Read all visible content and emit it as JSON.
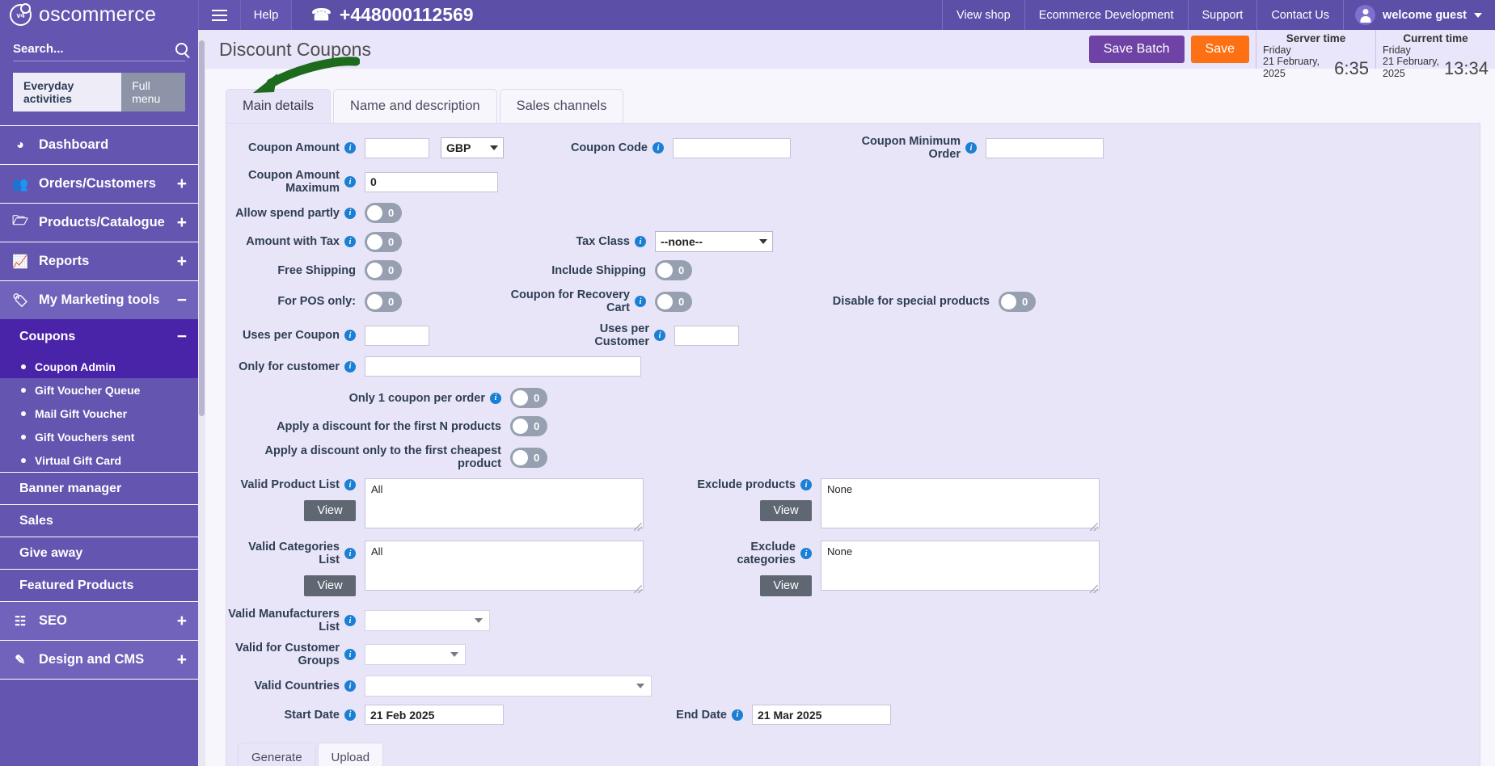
{
  "topbar": {
    "brand": "oscommerce",
    "logo_text": "v4",
    "help": "Help",
    "phone": "+448000112569",
    "nav": [
      {
        "label": "View shop"
      },
      {
        "label": "Ecommerce Development"
      },
      {
        "label": "Support"
      },
      {
        "label": "Contact Us"
      }
    ],
    "user": "welcome guest"
  },
  "sidebar": {
    "search_placeholder": "Search...",
    "toggle_tabs": [
      {
        "label": "Everyday activities",
        "active": true
      },
      {
        "label": "Full menu",
        "active": false
      }
    ],
    "items": [
      {
        "label": "Dashboard",
        "icon": "dashboard-icon",
        "expander": ""
      },
      {
        "label": "Orders/Customers",
        "icon": "users-icon",
        "expander": "+"
      },
      {
        "label": "Products/Catalogue",
        "icon": "folder-icon",
        "expander": "+"
      },
      {
        "label": "Reports",
        "icon": "chart-icon",
        "expander": "+"
      },
      {
        "label": "My Marketing tools",
        "icon": "tag-icon",
        "expander": "−"
      }
    ],
    "coupons_group": {
      "label": "Coupons",
      "expander": "−"
    },
    "coupons_children": [
      {
        "label": "Coupon Admin",
        "selected": true
      },
      {
        "label": "Gift Voucher Queue",
        "selected": false
      },
      {
        "label": "Mail Gift Voucher",
        "selected": false
      },
      {
        "label": "Gift Vouchers sent",
        "selected": false
      },
      {
        "label": "Virtual Gift Card",
        "selected": false
      }
    ],
    "flat_items": [
      {
        "label": "Banner manager"
      },
      {
        "label": "Sales"
      },
      {
        "label": "Give away"
      },
      {
        "label": "Featured Products"
      }
    ],
    "bottom_items": [
      {
        "label": "SEO",
        "icon": "sitemap-icon",
        "expander": "+"
      },
      {
        "label": "Design and CMS",
        "icon": "brush-icon",
        "expander": "+"
      }
    ]
  },
  "header": {
    "title": "Discount Coupons",
    "save_batch": "Save Batch",
    "save": "Save",
    "server_time": {
      "label": "Server time",
      "day": "Friday",
      "date": "21 February, 2025",
      "clock": "6:35"
    },
    "current_time": {
      "label": "Current time",
      "day": "Friday",
      "date": "21 February, 2025",
      "clock": "13:34"
    }
  },
  "tabs": [
    {
      "label": "Main details",
      "active": true
    },
    {
      "label": "Name and description",
      "active": false
    },
    {
      "label": "Sales channels",
      "active": false
    }
  ],
  "form": {
    "coupon_amount": {
      "label": "Coupon Amount",
      "value": "",
      "info": true
    },
    "currency": {
      "value": "GBP"
    },
    "coupon_code": {
      "label": "Coupon Code",
      "value": "",
      "info": true
    },
    "coupon_min_order": {
      "label": "Coupon Minimum Order",
      "value": "",
      "info": true
    },
    "coupon_amount_max": {
      "label": "Coupon Amount Maximum",
      "value": "0",
      "info": true
    },
    "allow_spend_partly": {
      "label": "Allow spend partly",
      "value": "0",
      "info": true
    },
    "amount_with_tax": {
      "label": "Amount with Tax",
      "value": "0",
      "info": true
    },
    "tax_class": {
      "label": "Tax Class",
      "value": "--none--",
      "info": true
    },
    "free_shipping": {
      "label": "Free Shipping",
      "value": "0",
      "info": false
    },
    "include_shipping": {
      "label": "Include Shipping",
      "value": "0",
      "info": false
    },
    "for_pos_only": {
      "label": "For POS only:",
      "value": "0",
      "info": false
    },
    "coupon_recovery_cart": {
      "label": "Coupon for Recovery Cart",
      "value": "0",
      "info": true
    },
    "disable_special_products": {
      "label": "Disable for special products",
      "value": "0",
      "info": false
    },
    "uses_per_coupon": {
      "label": "Uses per Coupon",
      "value": "",
      "info": true
    },
    "uses_per_customer": {
      "label": "Uses per Customer",
      "value": "",
      "info": true
    },
    "only_for_customer": {
      "label": "Only for customer",
      "value": "",
      "info": true
    },
    "only_one_coupon": {
      "label": "Only 1 coupon per order",
      "value": "0",
      "info": true
    },
    "first_n_products": {
      "label": "Apply a discount for the first N products",
      "value": "0",
      "info": false
    },
    "first_cheapest": {
      "label": "Apply a discount only to the first cheapest product",
      "value": "0",
      "info": false
    },
    "valid_product_list": {
      "label": "Valid Product List",
      "value": "All",
      "info": true,
      "button": "View"
    },
    "exclude_products": {
      "label": "Exclude products",
      "value": "None",
      "info": true,
      "button": "View"
    },
    "valid_categories_list": {
      "label": "Valid Categories List",
      "value": "All",
      "info": true,
      "button": "View"
    },
    "exclude_categories": {
      "label": "Exclude categories",
      "value": "None",
      "info": true,
      "button": "View"
    },
    "valid_manufacturers": {
      "label": "Valid Manufacturers List",
      "value": "",
      "info": true
    },
    "valid_customer_groups": {
      "label": "Valid for Customer Groups",
      "value": "",
      "info": true
    },
    "valid_countries": {
      "label": "Valid Countries",
      "value": "",
      "info": true
    },
    "start_date": {
      "label": "Start Date",
      "value": "21 Feb 2025",
      "info": true
    },
    "end_date": {
      "label": "End Date",
      "value": "21 Mar 2025",
      "info": true
    }
  },
  "bottom_tabs": [
    {
      "label": "Generate",
      "active": true
    },
    {
      "label": "Upload",
      "active": false
    }
  ],
  "annotation": {
    "type": "arrow",
    "color": "#1d6b1d",
    "points_to": "Main details"
  },
  "colors": {
    "brand_purple": "#6455b0",
    "topbar": "#5b4fa8",
    "accent_orange": "#fd7014",
    "save_batch_purple": "#6f42a5",
    "panel_bg": "#e8e5f9",
    "selected_nav": "#4a24a8"
  }
}
